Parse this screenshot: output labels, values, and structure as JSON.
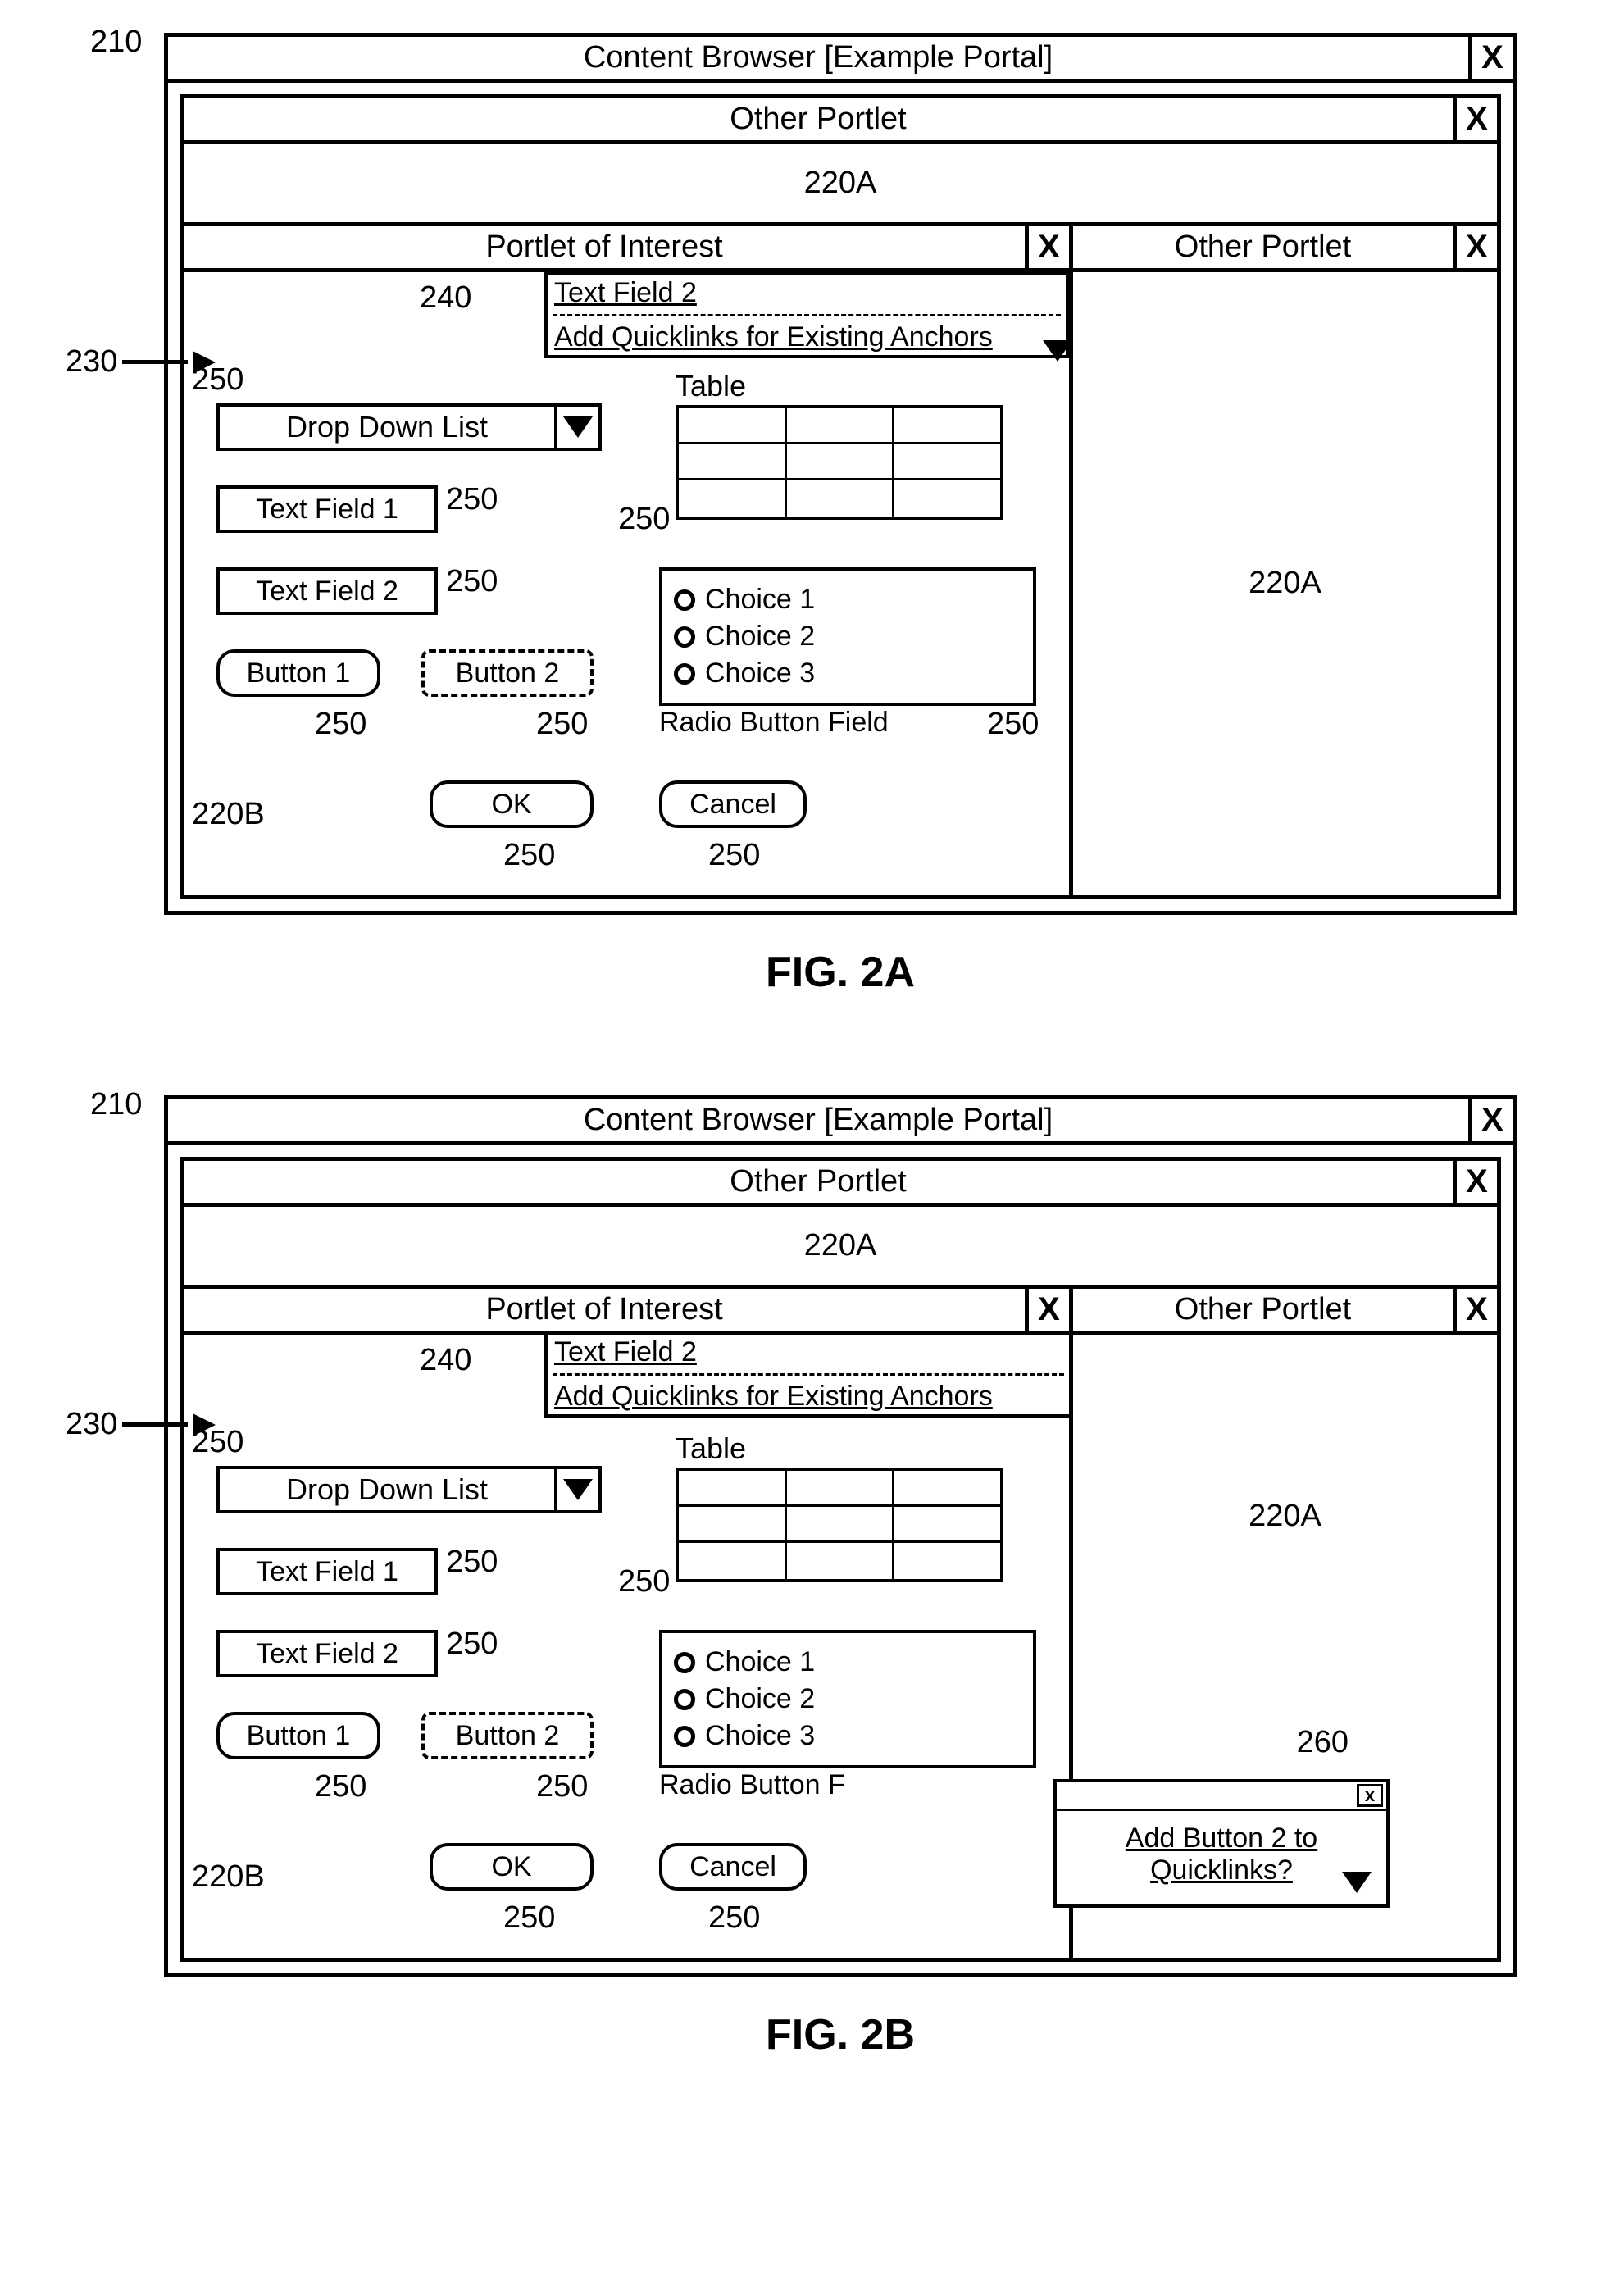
{
  "figA": {
    "ref210": "210",
    "browser_title": "Content Browser [Example Portal]",
    "close_x": "X",
    "portlet_top_title": "Other Portlet",
    "portlet_top_body": "220A",
    "poi_title": "Portlet of Interest",
    "side_title": "Other Portlet",
    "side_body": "220A",
    "ref230": "230",
    "ref240": "240",
    "popup_opt1": "Text Field 2",
    "popup_opt2": "Add Quicklinks for Existing Anchors",
    "ddl_ref": "250",
    "ddl_text": "Drop Down List",
    "tf1": "Text Field 1",
    "tf2": "Text Field 2",
    "b1": "Button 1",
    "b2": "Button 2",
    "table_lbl": "Table",
    "rad1": "Choice 1",
    "rad2": "Choice 2",
    "rad3": "Choice 3",
    "rad_lbl": "Radio Button Field",
    "ok": "OK",
    "cancel": "Cancel",
    "ref220B": "220B",
    "ref250": "250",
    "fig_label": "FIG. 2A"
  },
  "figB": {
    "ref210": "210",
    "browser_title": "Content Browser [Example Portal]",
    "close_x": "X",
    "portlet_top_title": "Other Portlet",
    "portlet_top_body": "220A",
    "poi_title": "Portlet of Interest",
    "side_title": "Other Portlet",
    "side_body": "220A",
    "ref230": "230",
    "ref240": "240",
    "popup_opt1": "Text Field 2",
    "popup_opt2": "Add Quicklinks for Existing Anchors",
    "ddl_ref": "250",
    "ddl_text": "Drop Down List",
    "tf1": "Text Field 1",
    "tf2": "Text Field 2",
    "b1": "Button 1",
    "b2": "Button 2",
    "table_lbl": "Table",
    "rad1": "Choice 1",
    "rad2": "Choice 2",
    "rad3": "Choice 3",
    "rad_lbl_trunc": "Radio Button F",
    "ok": "OK",
    "cancel": "Cancel",
    "ref220B": "220B",
    "ref250": "250",
    "ref260": "260",
    "popup260_text": "Add Button 2 to Quicklinks?",
    "popup260_x": "x",
    "fig_label": "FIG. 2B"
  }
}
